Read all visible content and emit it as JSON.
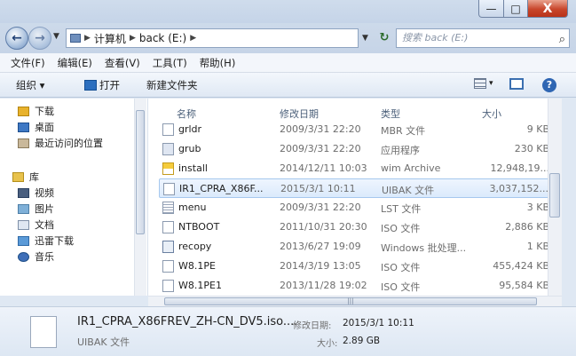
{
  "window": {
    "accent": "#c8462b"
  },
  "caption": {
    "minimize": "—",
    "maximize": "□",
    "close": "X"
  },
  "address": {
    "crumbs": [
      "计算机",
      "back (E:)"
    ],
    "search_placeholder": "搜索 back (E:)"
  },
  "menu": [
    "文件(F)",
    "编辑(E)",
    "查看(V)",
    "工具(T)",
    "帮助(H)"
  ],
  "toolbar": {
    "organize": "组织 ▾",
    "open": "打开",
    "new_folder": "新建文件夹"
  },
  "nav": [
    {
      "label": "下载",
      "icon": "download-folder-icon"
    },
    {
      "label": "桌面",
      "icon": "desktop-icon"
    },
    {
      "label": "最近访问的位置",
      "icon": "recent-places-icon"
    },
    {
      "label": "库",
      "icon": "library-icon"
    },
    {
      "label": "视频",
      "icon": "video-icon"
    },
    {
      "label": "图片",
      "icon": "pictures-icon"
    },
    {
      "label": "文档",
      "icon": "documents-icon"
    },
    {
      "label": "迅雷下载",
      "icon": "thunder-download-icon"
    },
    {
      "label": "音乐",
      "icon": "music-icon"
    }
  ],
  "columns": {
    "name": "名称",
    "date": "修改日期",
    "type": "类型",
    "size": "大小"
  },
  "files": [
    {
      "name": "grldr",
      "date": "2009/3/31 22:20",
      "type": "MBR 文件",
      "size": "9 KB",
      "icon": "file-icon"
    },
    {
      "name": "grub",
      "date": "2009/3/31 22:20",
      "type": "应用程序",
      "size": "230 KB",
      "icon": "exe-icon"
    },
    {
      "name": "install",
      "date": "2014/12/11 10:03",
      "type": "wim Archive",
      "size": "12,948,19...",
      "icon": "wim-icon"
    },
    {
      "name": "IR1_CPRA_X86F...",
      "date": "2015/3/1 10:11",
      "type": "UIBAK 文件",
      "size": "3,037,152...",
      "icon": "file-icon",
      "selected": true
    },
    {
      "name": "menu",
      "date": "2009/3/31 22:20",
      "type": "LST 文件",
      "size": "3 KB",
      "icon": "lst-icon"
    },
    {
      "name": "NTBOOT",
      "date": "2011/10/31 20:30",
      "type": "ISO 文件",
      "size": "2,886 KB",
      "icon": "file-icon"
    },
    {
      "name": "recopy",
      "date": "2013/6/27 19:09",
      "type": "Windows 批处理...",
      "size": "1 KB",
      "icon": "batch-icon"
    },
    {
      "name": "W8.1PE",
      "date": "2014/3/19 13:05",
      "type": "ISO 文件",
      "size": "455,424 KB",
      "icon": "file-icon"
    },
    {
      "name": "W8.1PE1",
      "date": "2013/11/28 19:02",
      "type": "ISO 文件",
      "size": "95,584 KB",
      "icon": "file-icon"
    }
  ],
  "details": {
    "name": "IR1_CPRA_X86FREV_ZH-CN_DV5.iso....",
    "type": "UIBAK 文件",
    "modified_label": "修改日期:",
    "modified": "2015/3/1 10:11",
    "size_label": "大小:",
    "size": "2.89 GB"
  }
}
